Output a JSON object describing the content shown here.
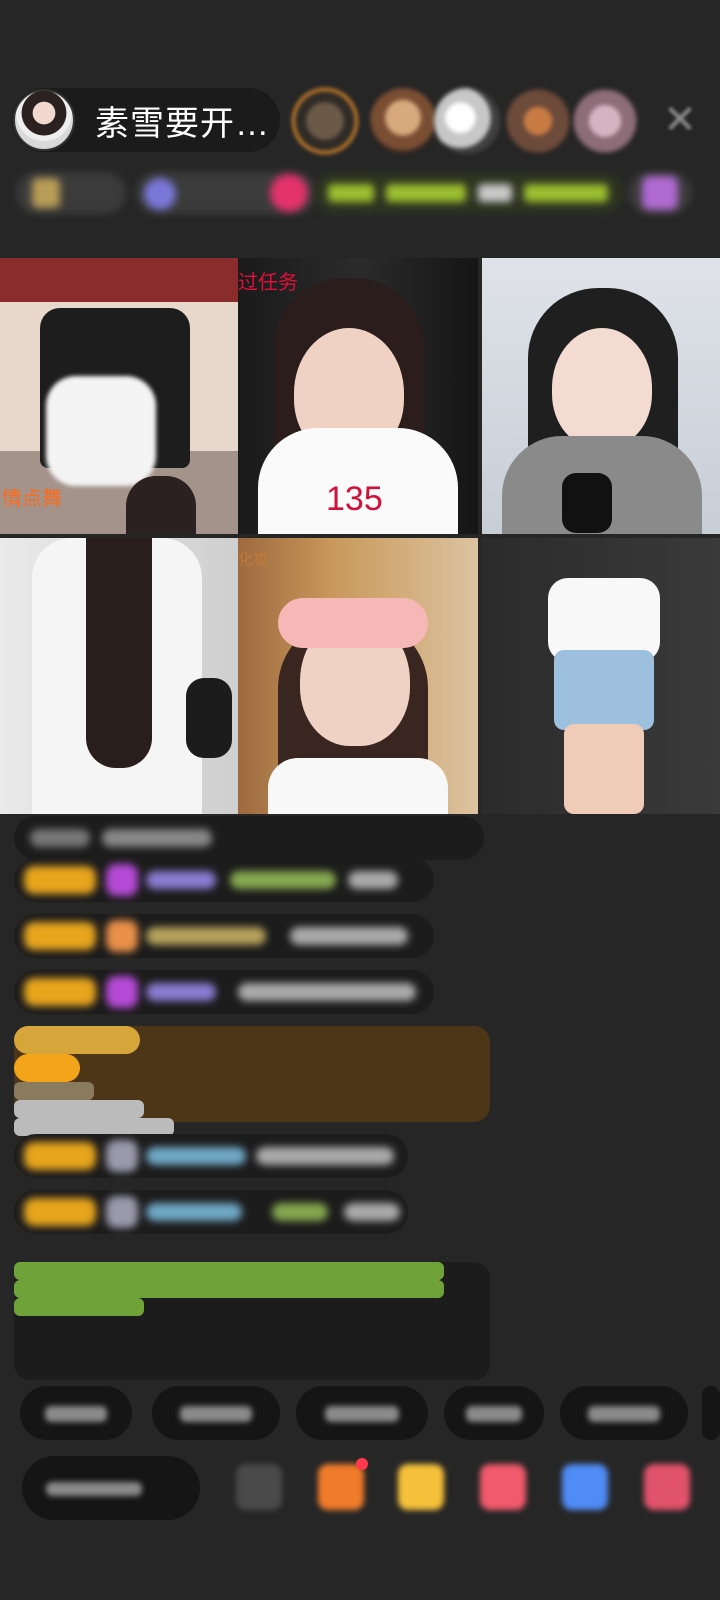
{
  "header": {
    "host_name": "素雪要开…",
    "host_avatar_icon": "host-avatar",
    "viewer_avatars": [
      "viewer-avatar-1",
      "viewer-avatar-2",
      "viewer-avatar-3",
      "viewer-avatar-4",
      "viewer-avatar-5"
    ],
    "close_icon": "close-icon",
    "close_glyph": "✕"
  },
  "grid": {
    "tiles": [
      {
        "label": "情点舞"
      },
      {
        "label": "过任务",
        "score": "135"
      },
      {
        "label": ""
      },
      {
        "label": ""
      },
      {
        "label": "化妆"
      },
      {
        "label": ""
      }
    ]
  },
  "colors": {
    "background": "#262626",
    "level_badge": "#e7a51d",
    "highlight_message": "#4d3617",
    "notice_text": "#6fa33a",
    "orange_label": "#ff6a1a",
    "red_label": "#e0103a"
  }
}
